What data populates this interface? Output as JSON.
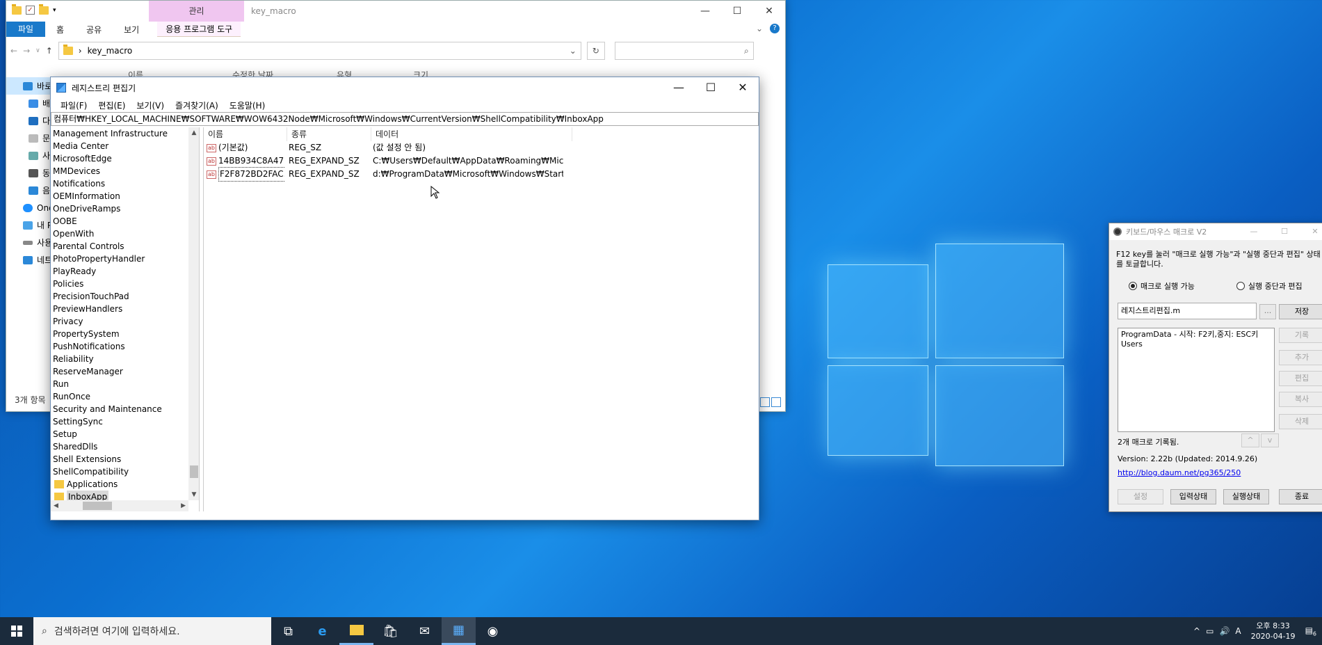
{
  "explorer": {
    "window_title": "key_macro",
    "manage_tab": "관리",
    "ribbon": {
      "file": "파일",
      "home": "홈",
      "share": "공유",
      "view": "보기",
      "app_tools": "응용 프로그램 도구"
    },
    "address": "key_macro",
    "columns": [
      "이름",
      "수정한 날짜",
      "유형",
      "크기"
    ],
    "nav_items": [
      "바로",
      "배",
      "다",
      "문",
      "사",
      "동",
      "음",
      "One",
      "내 P",
      "사용",
      "네트"
    ],
    "status": "3개 항목"
  },
  "regedit": {
    "title": "레지스트리 편집기",
    "menu": [
      "파일(F)",
      "편집(E)",
      "보기(V)",
      "즐겨찾기(A)",
      "도움말(H)"
    ],
    "address": "컴퓨터₩HKEY_LOCAL_MACHINE₩SOFTWARE₩WOW6432Node₩Microsoft₩Windows₩CurrentVersion₩ShellCompatibility₩InboxApp",
    "tree": [
      "Management Infrastructure",
      "Media Center",
      "MicrosoftEdge",
      "MMDevices",
      "Notifications",
      "OEMInformation",
      "OneDriveRamps",
      "OOBE",
      "OpenWith",
      "Parental Controls",
      "PhotoPropertyHandler",
      "PlayReady",
      "Policies",
      "PrecisionTouchPad",
      "PreviewHandlers",
      "Privacy",
      "PropertySystem",
      "PushNotifications",
      "Reliability",
      "ReserveManager",
      "Run",
      "RunOnce",
      "Security and Maintenance",
      "SettingSync",
      "Setup",
      "SharedDlls",
      "Shell Extensions",
      "ShellCompatibility"
    ],
    "tree_children": [
      "Applications",
      "InboxApp"
    ],
    "columns": {
      "name": "이름",
      "type": "종류",
      "data": "데이터"
    },
    "rows": [
      {
        "name": "(기본값)",
        "type": "REG_SZ",
        "data": "(값 설정 안 됨)"
      },
      {
        "name": "14BB934C8A47...",
        "type": "REG_EXPAND_SZ",
        "data": "C:₩Users₩Default₩AppData₩Roaming₩Microsof..."
      },
      {
        "name": "F2F872BD2FAC...",
        "type": "REG_EXPAND_SZ",
        "data": "d:₩ProgramData₩Microsoft₩Windows₩Start Me..."
      }
    ]
  },
  "macro": {
    "title": "키보드/마우스 매크로 V2",
    "description": "F12 key를 눌러 \"매크로 실행 가능\"과 \"실행 중단과 편집\" 상태를 토글합니다.",
    "radio_run": "매크로 실행 가능",
    "radio_edit": "실행 중단과 편집",
    "file_name": "레지스트리편집.m",
    "dots": "...",
    "save": "저장",
    "record": "기록",
    "add": "추가",
    "edit": "편집",
    "copy": "복사",
    "delete": "삭제",
    "macro_text_1": "ProgramData - 시작: F2키,중지: ESC키",
    "macro_text_2": "Users",
    "count": "2개 매크로 기록됨.",
    "up": "^",
    "down": "v",
    "version": "Version: 2.22b (Updated: 2014.9.26)",
    "link": "http://blog.daum.net/pg365/250",
    "settings": "설정",
    "input_state": "입력상태",
    "run_state": "실행상태",
    "exit": "종료"
  },
  "taskbar": {
    "search_placeholder": "검색하려면 여기에 입력하세요.",
    "time": "오후 8:33",
    "date": "2020-04-19",
    "ime": "A",
    "notif_count": "6"
  }
}
